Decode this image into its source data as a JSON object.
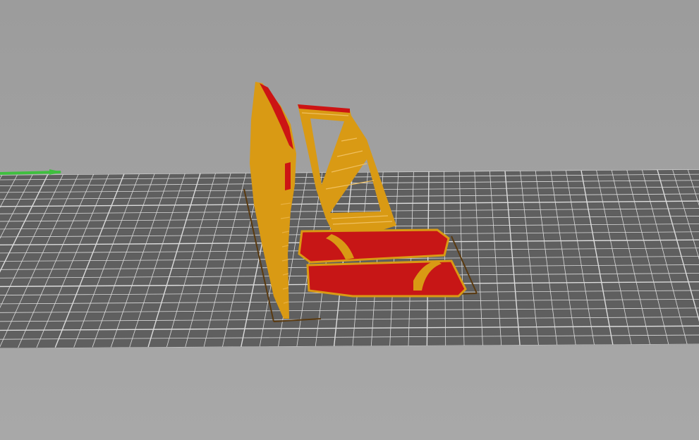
{
  "viewport": {
    "background_top": "#9c9c9c",
    "background_bottom": "#a8a8a8",
    "bed_color": "#5f5f5f",
    "grid_line_color": "#dcdcdc",
    "axis_color": "#3fbf3f"
  },
  "objects": [
    {
      "name": "tall-wing-part",
      "color": "#d99a14",
      "top_color": "#cc1414"
    },
    {
      "name": "triangle-frame-part",
      "color": "#d99a14"
    },
    {
      "name": "rear-flat-part",
      "color": "#c71616",
      "edge_color": "#d99a14"
    },
    {
      "name": "front-flat-part",
      "color": "#c71616",
      "edge_color": "#d99a14"
    }
  ],
  "bed_grid": {
    "columns": 50,
    "rows": 22
  }
}
